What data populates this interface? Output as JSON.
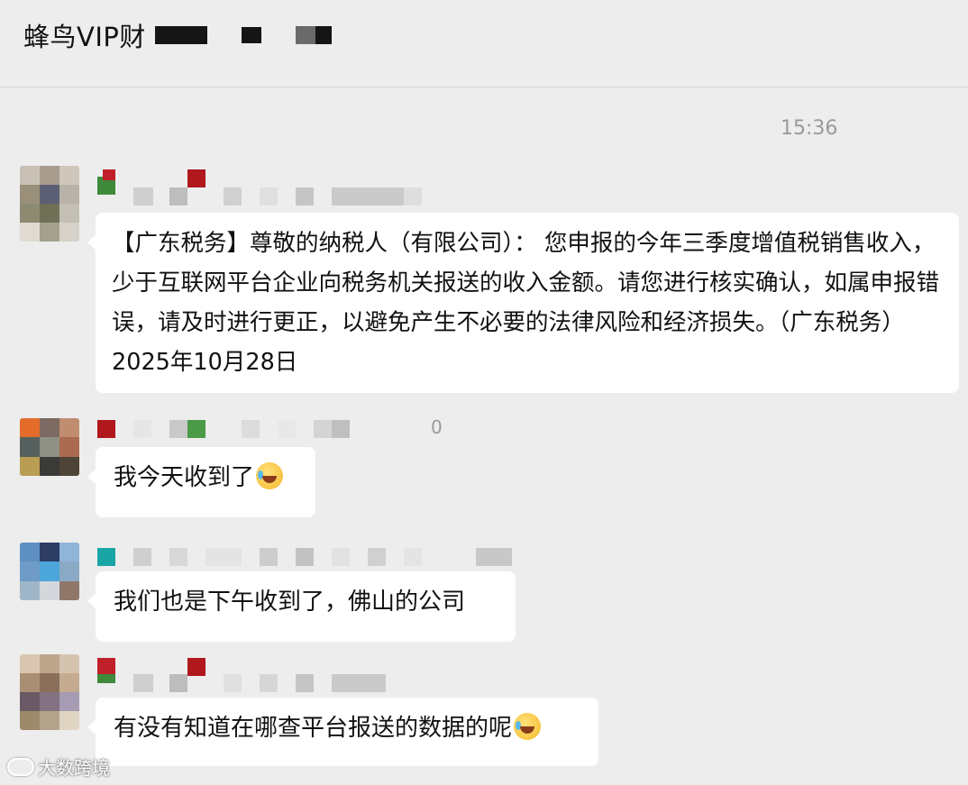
{
  "header": {
    "title": "蜂鸟VIP财"
  },
  "chat": {
    "time": "15:36",
    "messages": [
      {
        "text": "【广东税务】尊敬的纳税人（有限公司）： 您申报的今年三季度增值税销售收入，少于互联网平台企业向税务机关报送的收入金额。请您进行核实确认，如属申报错误，请及时进行更正，以避免产生不必要的法律风险和经济损失。（广东税务） 2025年10月28日"
      },
      {
        "text": "我今天收到了",
        "emoji": "sweat-smile-emoji",
        "meta": "0"
      },
      {
        "text": "我们也是下午收到了，佛山的公司"
      },
      {
        "text": "有没有知道在哪查平台报送的数据的呢",
        "emoji": "sweat-smile-emoji"
      }
    ]
  },
  "watermark": {
    "text": "大数跨境"
  }
}
